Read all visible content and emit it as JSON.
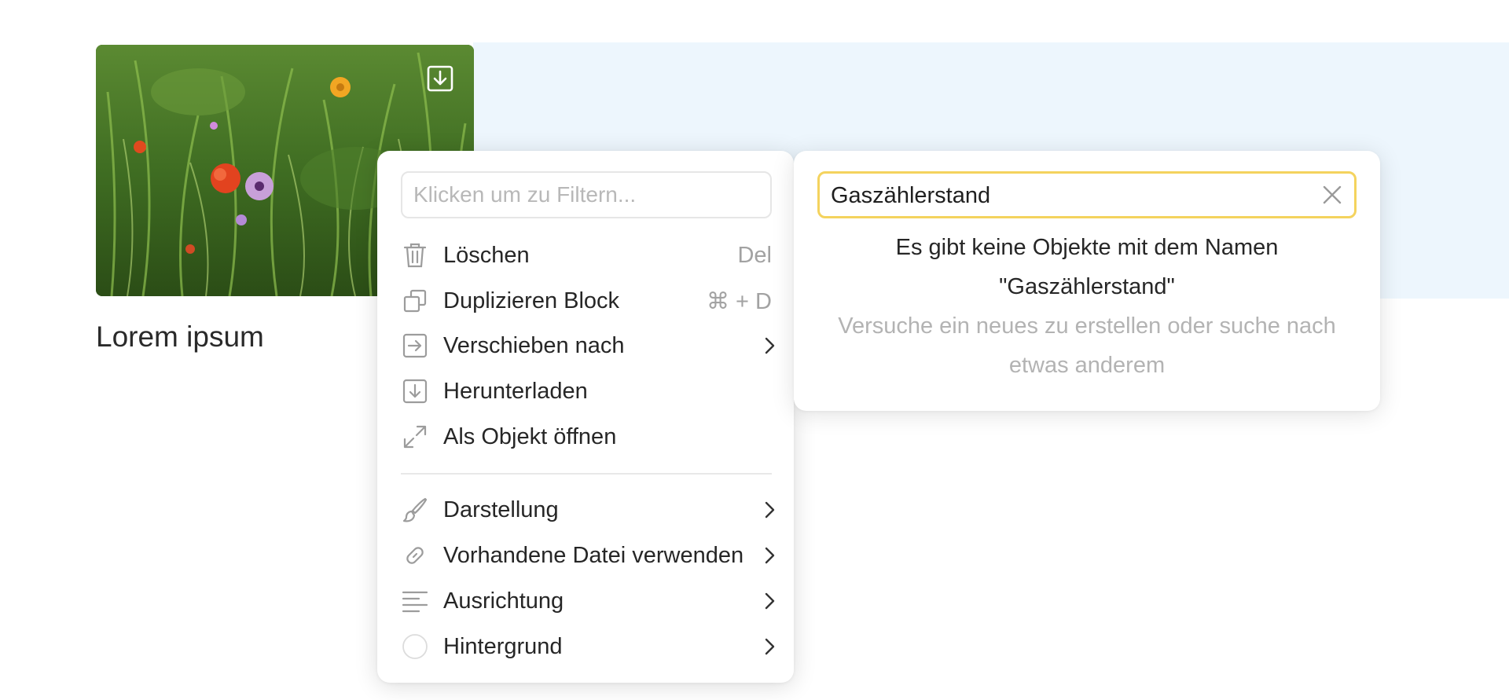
{
  "card": {
    "title": "Lorem ipsum",
    "image_icon": "download-icon"
  },
  "context_menu": {
    "filter_placeholder": "Klicken um zu Filtern...",
    "items": [
      {
        "label": "Löschen",
        "shortcut": "Del",
        "icon": "trash-icon"
      },
      {
        "label": "Duplizieren Block",
        "shortcut": "⌘ + D",
        "icon": "duplicate-icon"
      },
      {
        "label": "Verschieben nach",
        "icon": "move-to-icon",
        "submenu": true
      },
      {
        "label": "Herunterladen",
        "icon": "download-icon"
      },
      {
        "label": "Als Objekt öffnen",
        "icon": "expand-icon"
      },
      {
        "label": "Darstellung",
        "icon": "brush-icon",
        "submenu": true
      },
      {
        "label": "Vorhandene Datei verwenden",
        "icon": "link-icon",
        "submenu": true
      },
      {
        "label": "Ausrichtung",
        "icon": "align-left-icon",
        "submenu": true
      },
      {
        "label": "Hintergrund",
        "icon": "background-circle-icon",
        "submenu": true
      }
    ]
  },
  "object_search": {
    "value": "Gaszählerstand",
    "empty_line1": "Es gibt keine Objekte mit dem Namen",
    "empty_line2": "\"Gaszählerstand\"",
    "hint_line1": "Versuche ein neues zu erstellen oder suche nach",
    "hint_line2": "etwas anderem"
  },
  "colors": {
    "band": "#edf6fd",
    "search_border": "#f4d35e",
    "icon": "#9c9c9c"
  }
}
